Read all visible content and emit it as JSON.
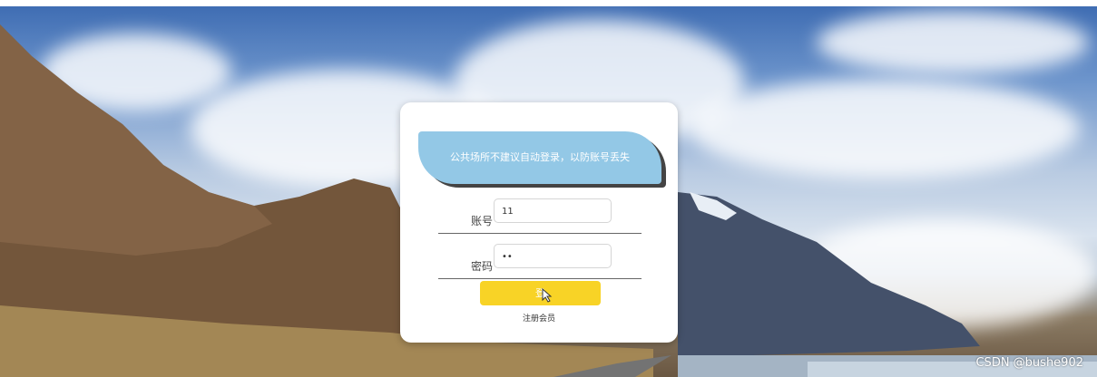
{
  "notice": {
    "text": "公共场所不建议自动登录，以防账号丢失"
  },
  "account": {
    "label": "账号",
    "value": "11"
  },
  "password": {
    "label": "密码",
    "value": "••"
  },
  "login": {
    "label": "登"
  },
  "register": {
    "label": "注册会员"
  },
  "watermark": {
    "text": "CSDN @bushe902"
  },
  "colors": {
    "notice_bg": "#93c8e6",
    "button_bg": "#f8d326"
  }
}
